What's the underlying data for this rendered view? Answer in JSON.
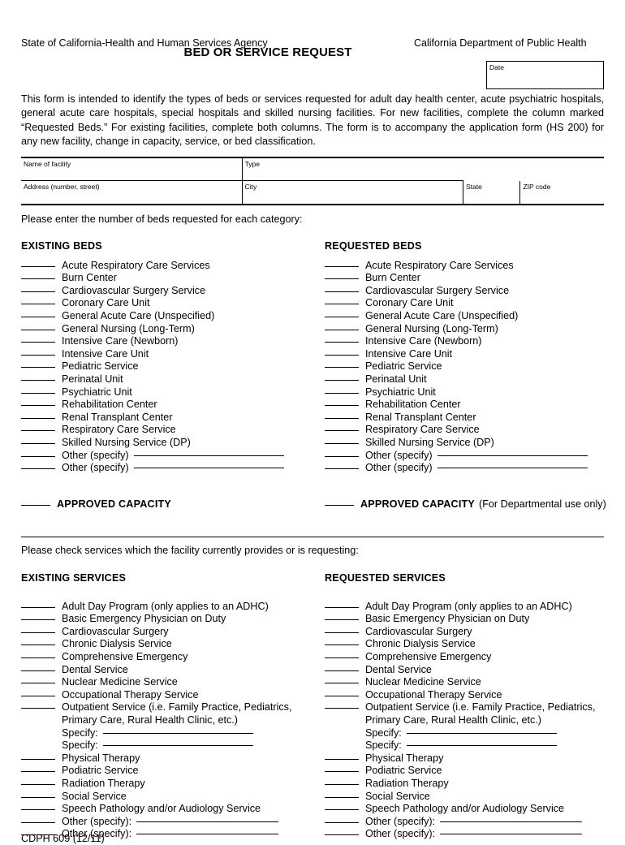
{
  "header": {
    "agency_left": "State of California-Health and Human Services Agency",
    "agency_right": "California Department of Public Health",
    "form_title": "BED OR SERVICE REQUEST",
    "date_label": "Date"
  },
  "intro": "This form is intended to identify the types of beds or services requested for adult day health center, acute psychiatric hospitals, general acute care hospitals, special hospitals and skilled nursing facilities.  For new facilities, complete the column marked “Requested Beds.”  For existing facilities, complete both columns.  The form is to accompany the application form (HS 200) for any new facility, change in capacity, service, or bed classification.",
  "facility_table": {
    "name_label": "Name of facility",
    "type_label": "Type",
    "address_label": "Address (number, street)",
    "city_label": "City",
    "state_label": "State",
    "zip_label": "ZIP code"
  },
  "beds_lead": "Please enter the number of beds requested for each category:",
  "beds": {
    "existing_heading": "EXISTING BEDS",
    "requested_heading": "REQUESTED BEDS",
    "items": [
      "Acute Respiratory Care Services",
      "Burn Center",
      "Cardiovascular Surgery Service",
      "Coronary Care Unit",
      "General Acute Care (Unspecified)",
      "General Nursing (Long-Term)",
      "Intensive Care (Newborn)",
      "Intensive Care Unit",
      "Pediatric Service",
      "Perinatal Unit",
      "Psychiatric Unit",
      "Rehabilitation Center",
      "Renal Transplant Center",
      "Respiratory Care Service",
      "Skilled Nursing Service (DP)"
    ],
    "other_label": "Other (specify)",
    "other_count": 2,
    "capacity_label": "APPROVED CAPACITY",
    "capacity_note": "(For Departmental use only)"
  },
  "services_lead": "Please check services which the facility currently provides or is requesting:",
  "services": {
    "existing_heading": "EXISTING SERVICES",
    "requested_heading": "REQUESTED SERVICES",
    "items": [
      "Adult Day Program (only applies to an ADHC)",
      "Basic Emergency Physician on Duty",
      "Cardiovascular Surgery",
      "Chronic Dialysis Service",
      "Comprehensive Emergency",
      "Dental Service",
      "Nuclear Medicine Service",
      "Occupational Therapy Service"
    ],
    "outpatient_line1": "Outpatient Service (i.e. Family Practice, Pediatrics,",
    "outpatient_line2": "Primary Care, Rural Health Clinic, etc.)",
    "specify_label": "Specify:",
    "specify_count": 2,
    "items_after": [
      "Physical Therapy",
      "Podiatric Service",
      "Radiation Therapy",
      "Social Service",
      "Speech Pathology and/or Audiology Service"
    ],
    "other_label": "Other (specify):",
    "other_count": 2
  },
  "footer": "CDPH 609 (12/11)"
}
